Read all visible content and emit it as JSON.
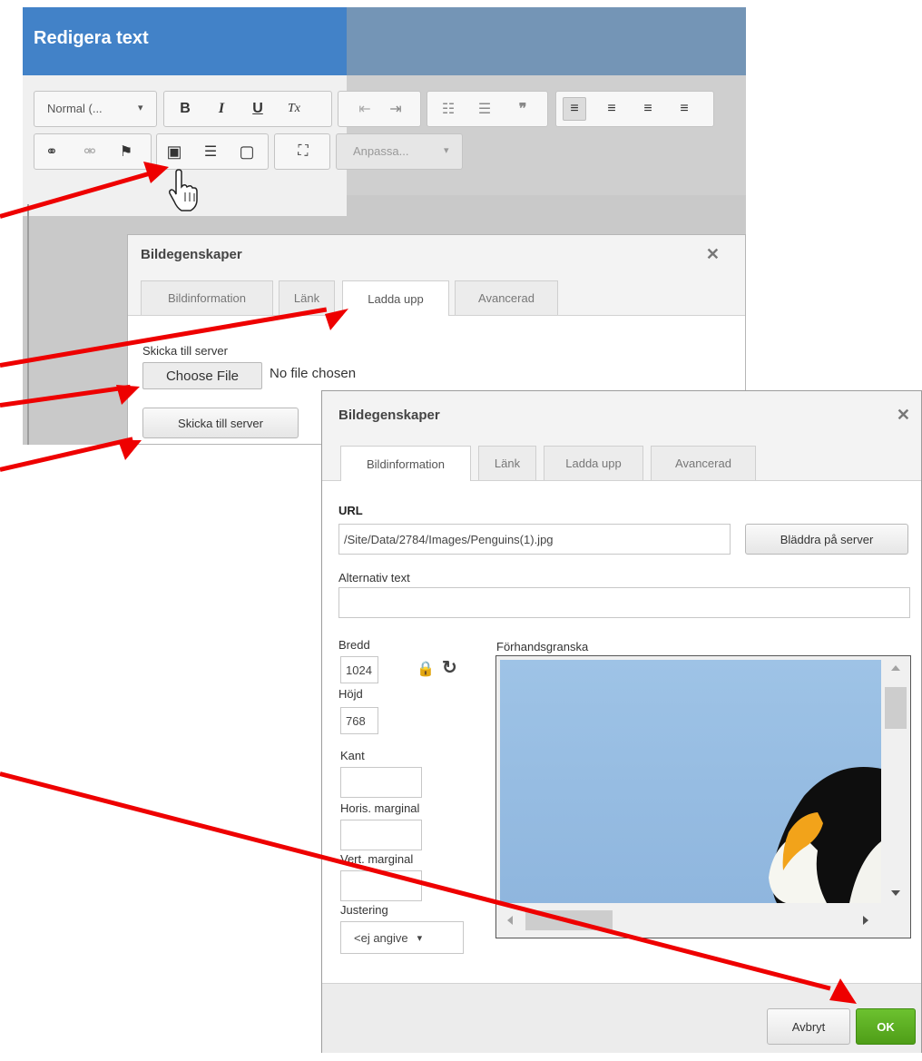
{
  "editor": {
    "title": "Redigera text",
    "format_combo": "Normal (...",
    "format_combo_arrow": "▾",
    "custom_combo": "Anpassa...",
    "custom_combo_arrow": "▾",
    "toolbar_glyphs": {
      "bold": "B",
      "italic": "I",
      "underline": "U",
      "clear_format": "Tx",
      "outdent": "⇤",
      "indent": "⇥",
      "numbered_list": "☷",
      "bullet_list": "☰",
      "blockquote": "❞",
      "align_left": "≡",
      "align_center": "≡",
      "align_right": "≡",
      "justify": "≡",
      "link": "⚭",
      "unlink": "⚮",
      "anchor": "⚑",
      "image": "▣",
      "hr": "☰",
      "iframe": "▢",
      "maximize": "⛶"
    }
  },
  "upload_dialog": {
    "title": "Bildegenskaper",
    "close": "✕",
    "tabs": [
      "Bildinformation",
      "Länk",
      "Ladda upp",
      "Avancerad"
    ],
    "send_label": "Skicka till server",
    "choose_file": "Choose File",
    "no_file": "No file chosen",
    "send_button": "Skicka till server"
  },
  "image_dialog": {
    "title": "Bildegenskaper",
    "close": "✕",
    "tabs": [
      "Bildinformation",
      "Länk",
      "Ladda upp",
      "Avancerad"
    ],
    "url_label": "URL",
    "url_value": "/Site/Data/2784/Images/Penguins(1).jpg",
    "browse_button": "Bläddra på server",
    "alt_label": "Alternativ text",
    "alt_value": "",
    "width_label": "Bredd",
    "width_value": "1024",
    "height_label": "Höjd",
    "height_value": "768",
    "lock_icon": "🔒",
    "reset_icon": "↻",
    "border_label": "Kant",
    "border_value": "",
    "hspace_label": "Horis. marginal",
    "hspace_value": "",
    "vspace_label": "Vert. marginal",
    "vspace_value": "",
    "align_label": "Justering",
    "align_value": "<ej angive",
    "align_arrow": "▾",
    "preview_label": "Förhandsgranska",
    "cancel_button": "Avbryt",
    "ok_button": "OK"
  },
  "colors": {
    "header": "#4282c8",
    "ok_green": "#5aac1f",
    "arrow": "#ee0000"
  }
}
